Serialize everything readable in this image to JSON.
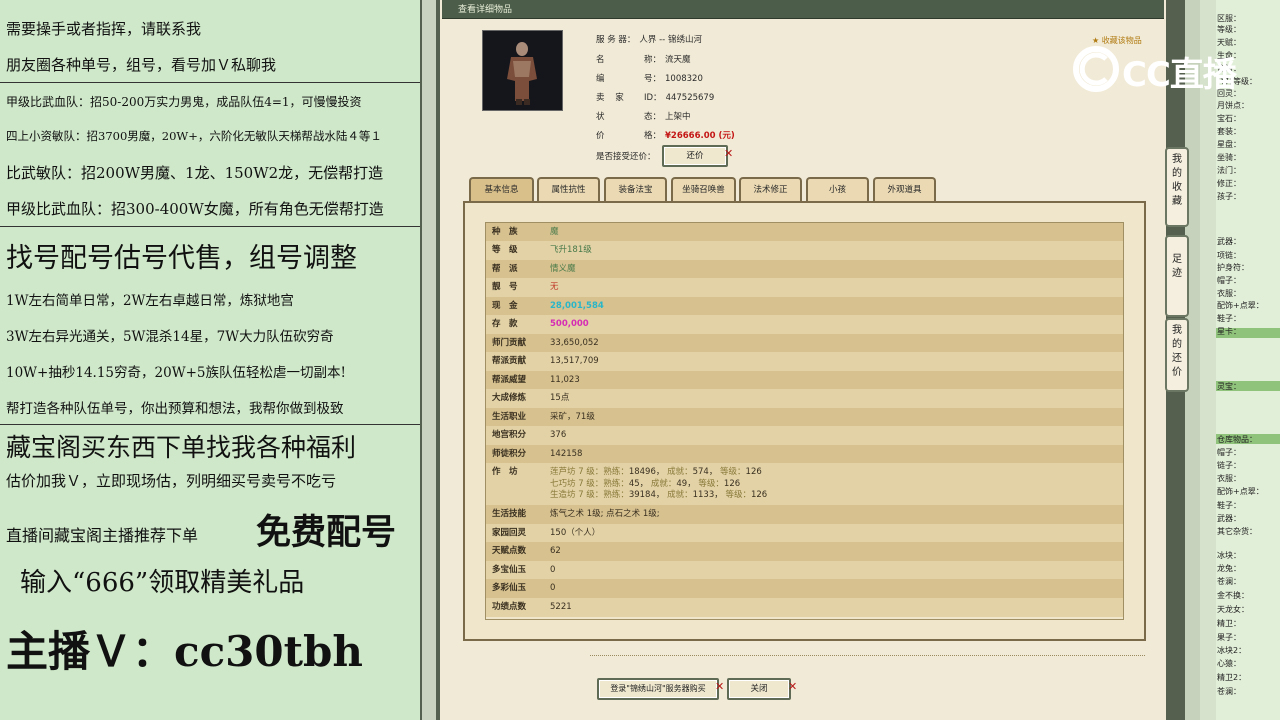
{
  "left_ads": {
    "lines": [
      "需要操手或者指挥，请联系我",
      "朋友圈各种单号，组号，看号加Ｖ私聊我",
      "甲级比武血队：招50-200万实力男鬼，成品队伍4=1，可慢慢投资",
      "四上小资敏队：招3700男魔，20W+，六阶化无敏队天梯帮战水陆４等１",
      "比武敏队：招200W男魔、1龙、150W2龙，无偿帮打造",
      "甲级比武血队：招300-400W女魔，所有角色无偿帮打造",
      "找号配号估号代售，组号调整",
      "1W左右简单日常，2W左右卓越日常，炼狱地宫",
      "3W左右异光通关，5W混杀14星，7W大力队伍砍穷奇",
      "10W+抽秒14.15穷奇，20W+5族队伍轻松虐一切副本!",
      "帮打造各种队伍单号，你出预算和想法，我帮你做到极致",
      "藏宝阁买东西下单找我各种福利",
      "估价加我Ｖ，立即现场估，列明细买号卖号不吃亏",
      "直播间藏宝阁主播推荐下单",
      "免费配号",
      "输入“666”领取精美礼品",
      "主播Ｖ：cc30tbh"
    ]
  },
  "window": {
    "title": "查看详细物品",
    "corner_link": "收藏该物品"
  },
  "item_info": {
    "server_label": "服 务 器：",
    "server_value": "人界 -- 锦绣山河",
    "name_label": "名",
    "name_label2": "称：",
    "name_value": "流天魔",
    "id_label": "编",
    "id_label2": "号：",
    "id_value": "1008320",
    "seller_label": "卖 家",
    "seller_label2": "ID：",
    "seller_value": "447525679",
    "status_label": "状",
    "status_label2": "态：",
    "status_value": "上架中",
    "price_label": "价",
    "price_label2": "格：",
    "price_value": "¥26666.00 (元)",
    "counter_label": "是否接受还价：",
    "counter_button": "还价"
  },
  "tabs": [
    "基本信息",
    "属性抗性",
    "装备法宝",
    "坐骑召唤兽",
    "法术修正",
    "小孩",
    "外观道具"
  ],
  "basic_table": [
    {
      "label": "种　族",
      "value": "魔",
      "color": "#4a7a4a"
    },
    {
      "label": "等　级",
      "value": "飞升181级",
      "color": "#4a7a4a"
    },
    {
      "label": "帮　派",
      "value": "情义魔",
      "color": "#4a7a4a"
    },
    {
      "label": "靓　号",
      "value": "无",
      "color": "#c0392b"
    },
    {
      "label": "现　金",
      "value": "28,001,584",
      "color": "#2ab6c8"
    },
    {
      "label": "存　款",
      "value": "500,000",
      "color": "#d62bb4"
    },
    {
      "label": "师门贡献",
      "value": "33,650,052",
      "color": "#3a3020"
    },
    {
      "label": "帮派贡献",
      "value": "13,517,709",
      "color": "#3a3020"
    },
    {
      "label": "帮派威望",
      "value": "11,023",
      "color": "#3a3020"
    },
    {
      "label": "大成修炼",
      "value": "15点",
      "color": "#3a3020"
    },
    {
      "label": "生活职业",
      "value": "采矿，71级",
      "color": "#3a3020"
    },
    {
      "label": "地宫积分",
      "value": "376",
      "color": "#3a3020"
    },
    {
      "label": "师徒积分",
      "value": "142158",
      "color": "#3a3020"
    }
  ],
  "workshop": {
    "label": "作　坊",
    "rows": [
      {
        "name": "莲芦坊 7 级：",
        "skill_label": "熟练：",
        "skill": "18496",
        "fame_label": "成就：",
        "fame": "574",
        "lvl_label": "等级：",
        "lvl": "126"
      },
      {
        "name": "七巧坊 7 级：",
        "skill_label": "熟练：",
        "skill": "45",
        "fame_label": "成就：",
        "fame": "49",
        "lvl_label": "等级：",
        "lvl": "126"
      },
      {
        "name": "生造坊 7 级：",
        "skill_label": "熟练：",
        "skill": "39184",
        "fame_label": "成就：",
        "fame": "1133",
        "lvl_label": "等级：",
        "lvl": "126"
      }
    ]
  },
  "basic_table2": [
    {
      "label": "生活技能",
      "value": "炼气之术 1级; 点石之术 1级;"
    },
    {
      "label": "家园回灵",
      "value": "150（个人）"
    },
    {
      "label": "天赋点数",
      "value": "62"
    },
    {
      "label": "多宝仙玉",
      "value": "0"
    },
    {
      "label": "多彩仙玉",
      "value": "0"
    },
    {
      "label": "功绩点数",
      "value": "5221"
    }
  ],
  "bottom_buttons": {
    "login": "登录\"锦绣山河\"服务器购买",
    "close": "关闭"
  },
  "logo_text": "CC直播",
  "side_buttons": [
    "我的收藏",
    "足迹",
    "我的还价"
  ],
  "right_panel": [
    "区服：",
    "等级：",
    "天赋：",
    "生命：",
    "修为：",
    "飞升等级：",
    "回灵：",
    "月饼点：",
    "宝石：",
    "套装：",
    "星盘：",
    "坐骑：",
    "法门：",
    "修正：",
    "孩子：",
    "武器：",
    "项链：",
    "护身符：",
    "帽子：",
    "衣服：",
    "配饰+点翠：",
    "鞋子：",
    "星卡：",
    "灵宝：",
    "仓库物品：",
    "帽子：",
    "链子：",
    "衣服：",
    "配饰+点翠：",
    "鞋子：",
    "武器：",
    "其它杂货：",
    "冰块：",
    "龙兔：",
    "苍澜：",
    "金不换：",
    "天龙女：",
    "精卫：",
    "果子：",
    "冰块2：",
    "心猿：",
    "精卫2：",
    "苍澜："
  ]
}
